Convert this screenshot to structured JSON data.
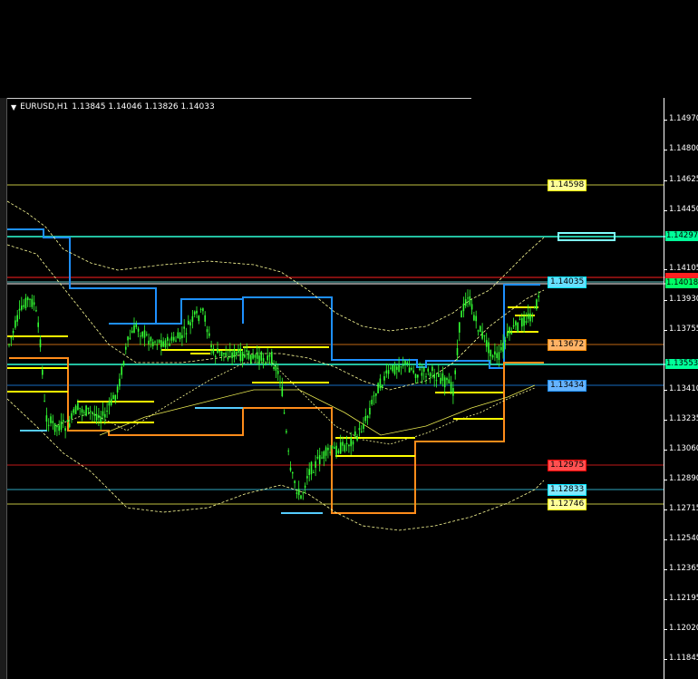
{
  "symbol": {
    "pair_tf": "EURUSD,H1",
    "ohlc": "1.13845 1.14046 1.13826 1.14033",
    "dropdown_icon": "triangle-down-icon"
  },
  "price_scale": {
    "top_price": 1.1512,
    "bottom_price": 1.1174,
    "ticks": [
      "1.14970",
      "1.14800",
      "1.14625",
      "1.14450",
      "1.14105",
      "1.13930",
      "1.13755",
      "1.13410",
      "1.13235",
      "1.13060",
      "1.12890",
      "1.12715",
      "1.12540",
      "1.12365",
      "1.12195",
      "1.12020",
      "1.11845"
    ]
  },
  "levels": [
    {
      "label": "1.14598",
      "price": 1.14598,
      "color": "#ffff55",
      "fill": "#ffff99",
      "label_border": "#ffff00"
    },
    {
      "label": "1.14035",
      "price": 1.14035,
      "color": "#7fffff",
      "fill": "#66e0ff",
      "label_border": "#00e5ff"
    },
    {
      "label": "1.13672",
      "price": 1.13672,
      "color": "#ff8c1a",
      "fill": "#ffb366",
      "label_border": "#ff8c00"
    },
    {
      "label": "1.13434",
      "price": 1.13434,
      "color": "#1e90ff",
      "fill": "#66b3ff",
      "label_border": "#1e90ff"
    },
    {
      "label": "1.12975",
      "price": 1.12975,
      "color": "#ff2020",
      "fill": "#ff5050",
      "label_border": "#ff0000"
    },
    {
      "label": "1.12833",
      "price": 1.12833,
      "color": "#40e0ff",
      "fill": "#80e8ff",
      "label_border": "#00e5ff"
    },
    {
      "label": "1.12746",
      "price": 1.12746,
      "color": "#ffff55",
      "fill": "#ffff99",
      "label_border": "#ffff00"
    }
  ],
  "axis_badges": [
    {
      "label": "1.14297",
      "price": 1.14297,
      "bg": "#00ff99"
    },
    {
      "label": "1.14018",
      "price": 1.14018,
      "bg": "#00ff66"
    },
    {
      "label": "1.13553",
      "price": 1.13553,
      "bg": "#00ff99"
    }
  ],
  "colors": {
    "candles": "#33ff33",
    "blue_step": "#1e90ff",
    "orange_step": "#ff8c1a",
    "yellow_segments": "#ffff00",
    "bands": "#ffff99",
    "red_line": "#ff2020",
    "cyan_bright": "#2fffd5"
  }
}
